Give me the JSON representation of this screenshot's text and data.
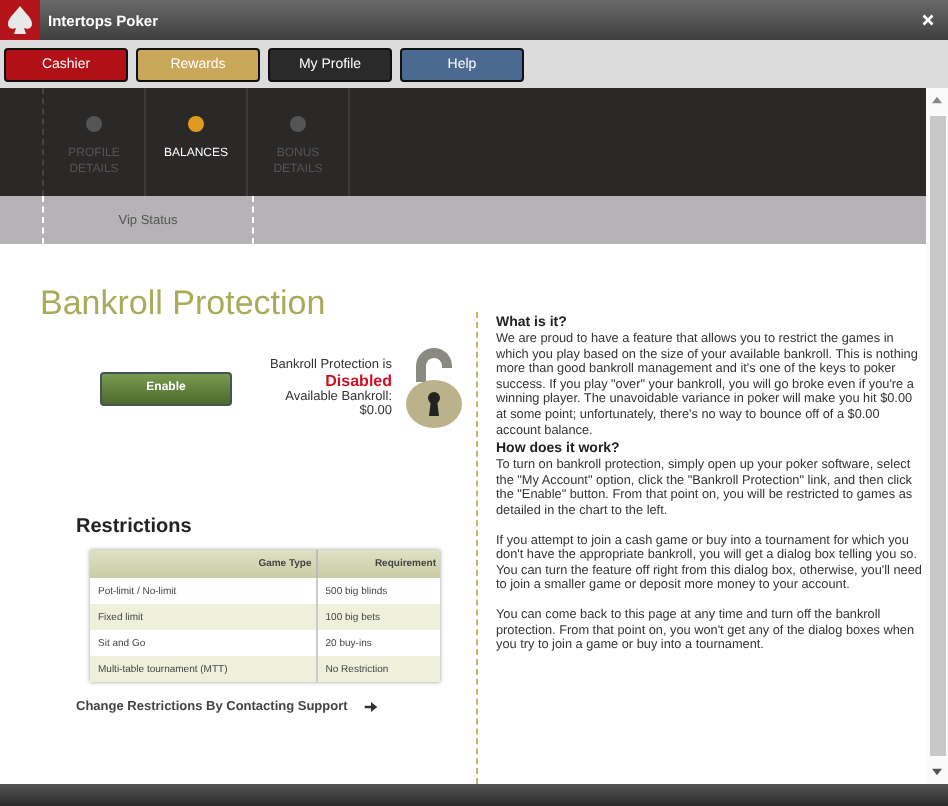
{
  "window": {
    "title": "Intertops Poker"
  },
  "main_tabs": [
    {
      "label": "Cashier",
      "color": "#b01016"
    },
    {
      "label": "Rewards",
      "color": "#c9a85a"
    },
    {
      "label": "My Profile",
      "color": "#2a2a2a"
    },
    {
      "label": "Help",
      "color": "#4a6a92"
    }
  ],
  "nav_steps": [
    {
      "label": "PROFILE DETAILS",
      "selected": false
    },
    {
      "label": "BALANCES",
      "selected": true
    },
    {
      "label": "BONUS DETAILS",
      "selected": false
    }
  ],
  "sub_nav": [
    {
      "label": "Vip Status"
    }
  ],
  "bankroll": {
    "heading": "Bankroll Protection",
    "enable_button": "Enable",
    "status_label": "Bankroll Protection is",
    "status_value": "Disabled",
    "available_label": "Available Bankroll:",
    "available_value": "$0.00"
  },
  "restrictions": {
    "heading": "Restrictions",
    "columns": [
      "Game Type",
      "Requirement"
    ],
    "rows": [
      [
        "Pot-limit / No-limit",
        "500 big blinds"
      ],
      [
        "Fixed limit",
        "100 big bets"
      ],
      [
        "Sit and Go",
        "20 buy-ins"
      ],
      [
        "Multi-table tournament (MTT)",
        "No Restriction"
      ]
    ],
    "link": "Change Restrictions By Contacting Support"
  },
  "info": [
    {
      "kind": "heading",
      "text": "What is it?"
    },
    {
      "kind": "paragraph",
      "text": "We are proud to have a feature that allows you to restrict the games in which you play based on the size of your available bankroll. This is nothing more than good bankroll management and it's one of the keys to poker success. If you play \"over\" your bankroll, you will go broke even if you're a winning player. The unavoidable variance in poker will make you hit $0.00 at some point; unfortunately, there's no way to bounce off of a $0.00 account balance."
    },
    {
      "kind": "heading",
      "text": "How does it work?"
    },
    {
      "kind": "paragraph",
      "text": "To turn on bankroll protection, simply open up your poker software, select the \"My Account\" option, click the \"Bankroll Protection\" link, and then click the \"Enable\" button. From that point on, you will be restricted to games as detailed in the chart to the left."
    },
    {
      "kind": "paragraph",
      "text": "If you attempt to join a cash game or buy into a tournament for which you don't have the appropriate bankroll, you will get a dialog box telling you so. You can turn the feature off right from this dialog box, otherwise, you'll need to join a smaller game or deposit more money to your account."
    },
    {
      "kind": "paragraph",
      "text": "You can come back to this page at any time and turn off the bankroll protection. From that point on, you won't get any of the dialog boxes when you try to join a game or buy into a tournament."
    }
  ]
}
